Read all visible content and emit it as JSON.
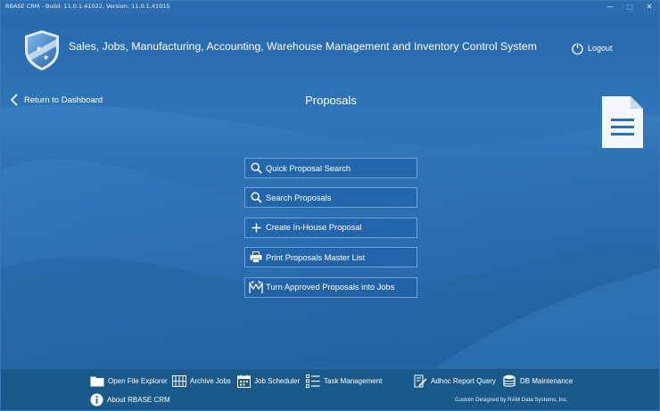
{
  "window": {
    "title": "RBASE CRM - Build: 11.0.1.41022, Version: 11.0.1.41015",
    "minimize": "—",
    "maximize": "□",
    "close": "✕"
  },
  "header": {
    "app_title": "Sales, Jobs, Manufacturing, Accounting, Warehouse Management and Inventory Control System",
    "logout_label": "Logout",
    "logo_icon": "shield-logo-icon"
  },
  "nav": {
    "back_label": "Return to Dashboard",
    "page_title": "Proposals",
    "page_icon": "document-icon"
  },
  "menu": {
    "items": [
      {
        "label": "Quick Proposal Search",
        "icon": "search-icon"
      },
      {
        "label": "Search Proposals",
        "icon": "search-icon"
      },
      {
        "label": "Create In-House Proposal",
        "icon": "plus-icon"
      },
      {
        "label": "Print Proposals Master List",
        "icon": "printer-icon"
      },
      {
        "label": "Turn Approved Proposals into Jobs",
        "icon": "convert-icon"
      }
    ]
  },
  "footer": {
    "open_file_explorer": "Open File Explorer",
    "archive_jobs": "Archive Jobs",
    "job_scheduler": "Job Scheduler",
    "task_management": "Task Management",
    "adhoc_report_query": "Adhoc Report Query",
    "db_maintenance": "DB Maintenance",
    "about": "About RBASE CRM",
    "credit": "Custom Designed by RAM Data Systems, Inc."
  },
  "colors": {
    "background": "#2c70b3",
    "footer": "#1a5a8a",
    "button_border": "#6fa2d6",
    "text": "#ffffff"
  }
}
